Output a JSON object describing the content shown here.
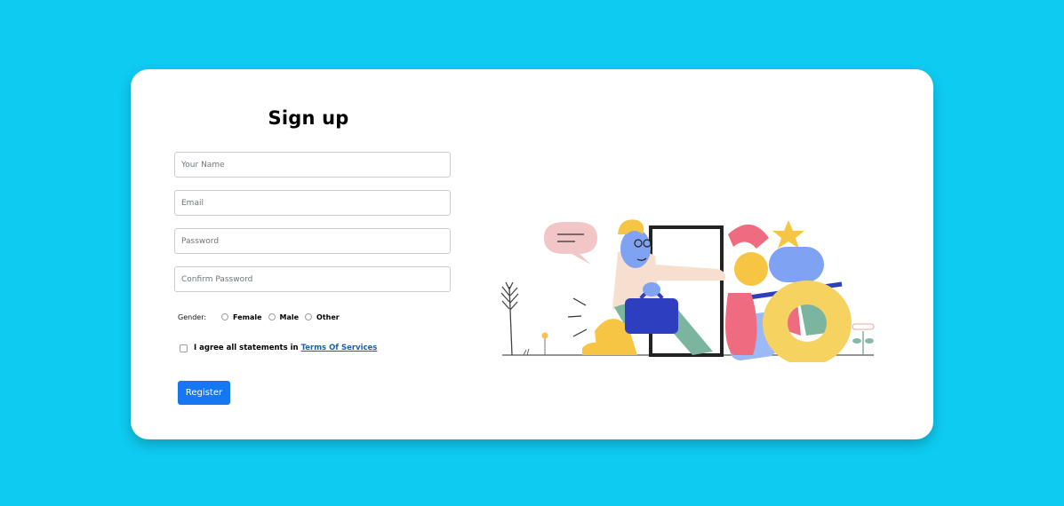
{
  "form": {
    "title": "Sign up",
    "name_placeholder": "Your Name",
    "email_placeholder": "Email",
    "password_placeholder": "Password",
    "confirm_placeholder": "Confirm Password",
    "gender_label": "Gender:",
    "gender_options": [
      "Female",
      "Male",
      "Other"
    ],
    "agree_text": "I agree all statements in",
    "terms_link": "Terms Of Services",
    "register_label": "Register"
  },
  "colors": {
    "background": "#0ecbf1",
    "card": "#ffffff",
    "primary_button": "#1677f2",
    "link": "#1a5fb4"
  },
  "illustration": {
    "icon": "person-walking-through-door-illustration"
  }
}
